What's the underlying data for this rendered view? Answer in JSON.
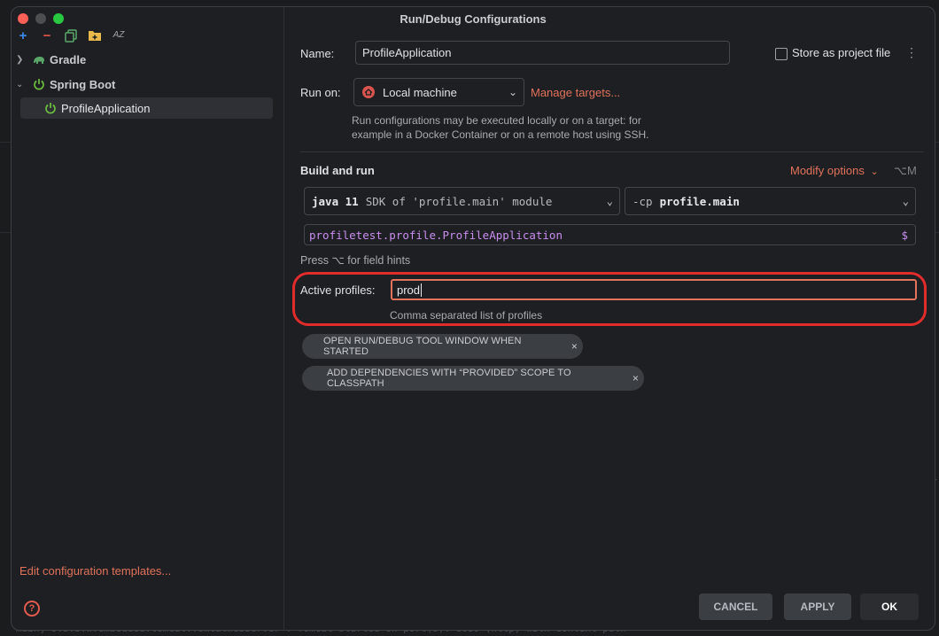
{
  "window": {
    "title": "Run/Debug Configurations"
  },
  "background": {
    "log_text": "main] o.s.b.w.embedded.tomcat.TomcatWebServer  : Tomcat started on port(s): 8080 (http) with context path",
    "edge_text": "/L"
  },
  "sidebar": {
    "toolbar": [
      {
        "icon": "plus-icon",
        "glyph": "+"
      },
      {
        "icon": "minus-icon",
        "glyph": "−"
      },
      {
        "icon": "copy-icon"
      },
      {
        "icon": "folder-plus-icon"
      },
      {
        "icon": "sort-az-icon",
        "glyph": "AZ"
      }
    ],
    "tree": [
      {
        "label": "Gradle",
        "icon": "gradle-elephant-icon",
        "expanded": false
      },
      {
        "label": "Spring Boot",
        "icon": "spring-boot-power-icon",
        "expanded": true
      },
      {
        "label": "ProfileApplication",
        "icon": "spring-boot-power-icon",
        "selected": true
      }
    ],
    "edit_templates": "Edit configuration templates...",
    "help_glyph": "?"
  },
  "main": {
    "name_label": "Name:",
    "name_value": "ProfileApplication",
    "store_label": "Store as project file",
    "store_checked": false,
    "run_on_label": "Run on:",
    "run_on_value": "Local machine",
    "manage_targets": "Manage targets...",
    "run_on_hint_1": "Run configurations may be executed locally or on a target: for",
    "run_on_hint_2": "example in a Docker Container or on a remote host using SSH.",
    "build_and_run": "Build and run",
    "modify_options": "Modify options",
    "modify_shortcut": "⌥M",
    "sdk_bold": "java 11",
    "sdk_rest": "SDK of 'profile.main' module",
    "cp_prefix": "-cp",
    "cp_value": "profile.main",
    "main_class": "profiletest.profile.ProfileApplication",
    "main_class_icon": "$",
    "field_hints": "Press ⌥ for field hints",
    "active_profiles_label": "Active profiles:",
    "active_profiles_value": "prod",
    "active_profiles_hint": "Comma separated list of profiles",
    "chips": [
      {
        "label": "OPEN RUN/DEBUG TOOL WINDOW WHEN STARTED"
      },
      {
        "label": "ADD DEPENDENCIES WITH “PROVIDED” SCOPE TO CLASSPATH"
      }
    ],
    "chip_close": "×"
  },
  "footer": {
    "cancel": "CANCEL",
    "apply": "APPLY",
    "ok": "OK"
  },
  "colors": {
    "accent": "#e2725b",
    "highlight": "#e12c2c",
    "link_blue": "#3d8cf0",
    "bg": "#1e1f22"
  }
}
